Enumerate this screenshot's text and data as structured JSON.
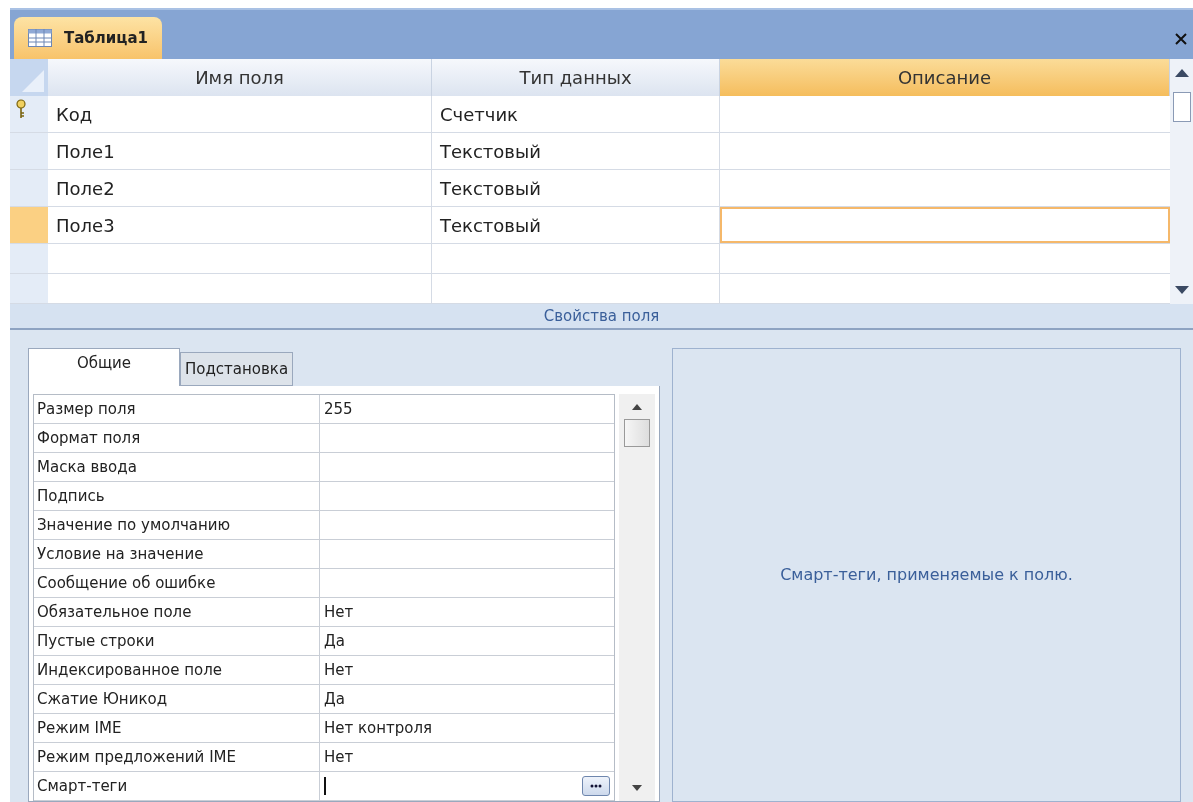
{
  "document_tab": {
    "title": "Таблица1"
  },
  "design_grid": {
    "columns": [
      {
        "label": "Имя поля",
        "selected": false
      },
      {
        "label": "Тип данных",
        "selected": false
      },
      {
        "label": "Описание",
        "selected": true
      }
    ],
    "rows": [
      {
        "name": "Код",
        "type": "Счетчик",
        "primary_key": true,
        "selected": false
      },
      {
        "name": "Поле1",
        "type": "Текстовый",
        "primary_key": false,
        "selected": false
      },
      {
        "name": "Поле2",
        "type": "Текстовый",
        "primary_key": false,
        "selected": false
      },
      {
        "name": "Поле3",
        "type": "Текстовый",
        "primary_key": false,
        "selected": true
      }
    ]
  },
  "properties_bar": {
    "title": "Свойства поля"
  },
  "property_tabs": [
    {
      "label": "Общие",
      "selected": true
    },
    {
      "label": "Подстановка",
      "selected": false
    }
  ],
  "properties": [
    {
      "label": "Размер поля",
      "value": "255",
      "kind": "text"
    },
    {
      "label": "Формат поля",
      "kind": "text"
    },
    {
      "label": "Маска ввода",
      "kind": "text"
    },
    {
      "label": "Подпись",
      "kind": "text"
    },
    {
      "label": "Значение по умолчанию",
      "kind": "text"
    },
    {
      "label": "Условие на значение",
      "kind": "text"
    },
    {
      "label": "Сообщение об ошибке",
      "kind": "text"
    },
    {
      "label": "Обязательное поле",
      "value": "Нет",
      "kind": "text"
    },
    {
      "label": "Пустые строки",
      "value": "Да",
      "kind": "text"
    },
    {
      "label": "Индексированное поле",
      "value": "Нет",
      "kind": "text"
    },
    {
      "label": "Сжатие Юникод",
      "value": "Да",
      "kind": "text"
    },
    {
      "label": "Режим IME",
      "value": "Нет контроля",
      "kind": "text"
    },
    {
      "label": "Режим предложений IME",
      "value": "Нет",
      "kind": "text"
    },
    {
      "label": "Смарт-теги",
      "kind": "builder"
    }
  ],
  "help_text": "Смарт-теги, применяемые к полю."
}
